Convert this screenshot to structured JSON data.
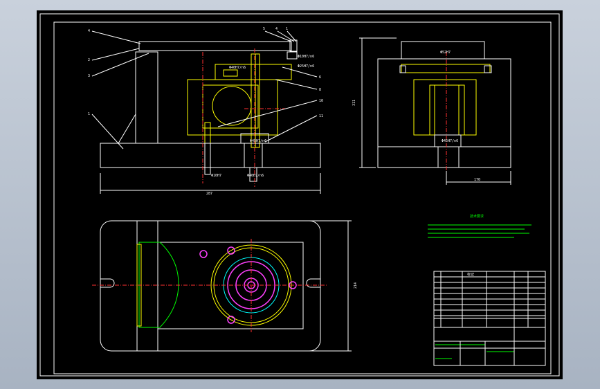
{
  "front_view": {
    "balloons": [
      "4",
      "2",
      "3",
      "1",
      "5",
      "4",
      "1",
      "6",
      "8",
      "10",
      "11"
    ],
    "fits": [
      "Φ10H7",
      "Φ10H7/n6",
      "Φ25H7/n6",
      "Φ40H7/n6",
      "Φ40H7/n6",
      "Φ45H7/n6"
    ],
    "width_dim": "287"
  },
  "side_view": {
    "height_dim": "311",
    "width_dim": "170",
    "fit_top": "Φ52H7",
    "fit_bottom": "Φ45H7/n6"
  },
  "plan_view": {
    "height_dim": "214"
  },
  "notes": {
    "title": "技术要求"
  },
  "title_block": {
    "header": "标记"
  },
  "colors": {
    "background": "#000000",
    "outline": "#ffffff",
    "hatch": "#00ff00",
    "part": "#ffff00",
    "centerline": "#ff3030",
    "hole": "#ff40ff"
  }
}
